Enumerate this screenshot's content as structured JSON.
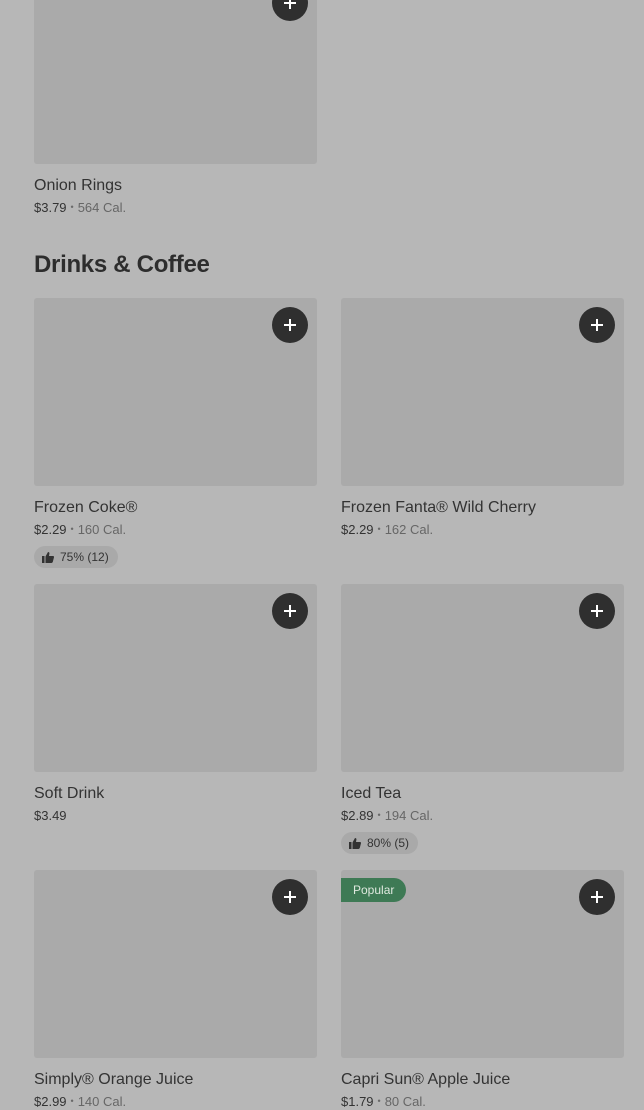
{
  "top_item": {
    "name": "Onion Rings",
    "price": "$3.79",
    "calories": "564 Cal."
  },
  "section": {
    "title": "Drinks & Coffee"
  },
  "items": [
    {
      "name": "Frozen Coke®",
      "price": "$2.29",
      "calories": "160 Cal.",
      "rating": "75% (12)"
    },
    {
      "name": "Frozen Fanta® Wild Cherry",
      "price": "$2.29",
      "calories": "162 Cal."
    },
    {
      "name": "Soft Drink",
      "price": "$3.49"
    },
    {
      "name": "Iced Tea",
      "price": "$2.89",
      "calories": "194 Cal.",
      "rating": "80% (5)"
    },
    {
      "name": "Simply® Orange Juice",
      "price": "$2.99",
      "calories": "140 Cal."
    },
    {
      "name": "Capri Sun® Apple Juice",
      "price": "$1.79",
      "calories": "80 Cal.",
      "badge": "Popular"
    }
  ],
  "icons": {
    "add": "plus-icon",
    "rating": "thumbs-up-icon"
  },
  "colors": {
    "background": "#b7b7b7",
    "image_placeholder": "#aaaaaa",
    "add_button": "#2f2f2f",
    "popular_badge": "#3e7a55"
  }
}
